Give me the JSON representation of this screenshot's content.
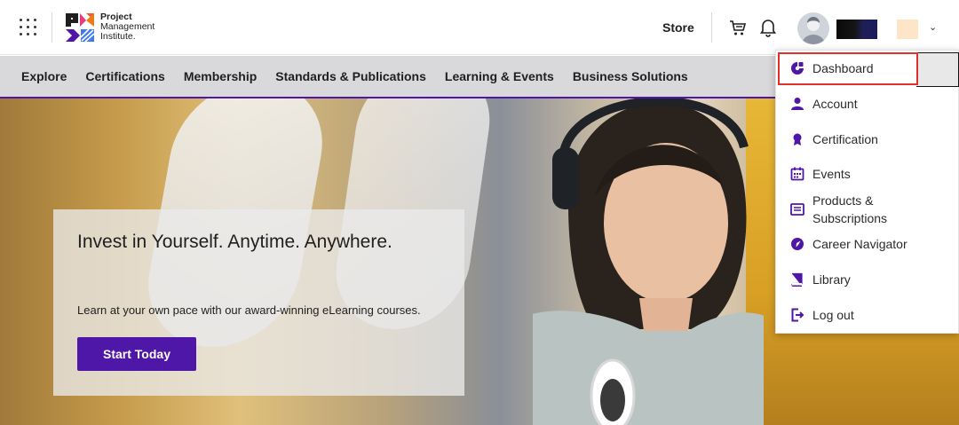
{
  "header": {
    "logo": {
      "line1": "Project",
      "line2": "Management",
      "line3": "Institute."
    },
    "store_label": "Store",
    "icons": {
      "apps": "apps-grid-icon",
      "cart": "cart-icon",
      "bell": "bell-icon",
      "avatar": "user-avatar-icon",
      "caret": "chevron-down-icon"
    }
  },
  "nav": {
    "items": [
      {
        "label": "Explore"
      },
      {
        "label": "Certifications"
      },
      {
        "label": "Membership"
      },
      {
        "label": "Standards & Publications"
      },
      {
        "label": "Learning & Events"
      },
      {
        "label": "Business Solutions"
      }
    ],
    "accent_color": "#4f17a8"
  },
  "hero": {
    "title": "Invest in Yourself. Anytime. Anywhere.",
    "subtitle": "Learn at your own pace with our award-winning eLearning courses.",
    "cta_label": "Start Today"
  },
  "user_menu": {
    "items": [
      {
        "label": "Dashboard",
        "icon": "dashboard-icon",
        "highlighted": true
      },
      {
        "label": "Account",
        "icon": "person-icon"
      },
      {
        "label": "Certification",
        "icon": "ribbon-icon"
      },
      {
        "label": "Events",
        "icon": "calendar-icon"
      },
      {
        "label": "Products &",
        "label2": "Subscriptions",
        "icon": "list-icon"
      },
      {
        "label": "Career Navigator",
        "icon": "compass-icon"
      },
      {
        "label": "Library",
        "icon": "book-icon"
      },
      {
        "label": "Log out",
        "icon": "logout-icon"
      }
    ],
    "icon_color": "#4f17a8",
    "highlight_color": "#e0302a"
  }
}
